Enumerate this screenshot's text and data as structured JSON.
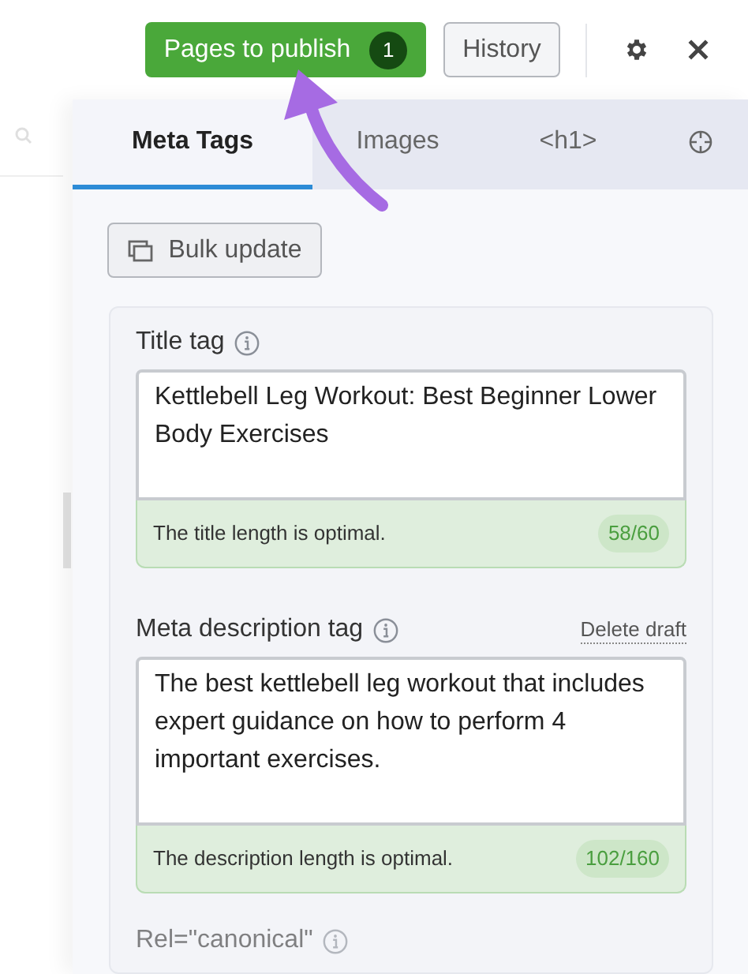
{
  "header": {
    "publish_button": {
      "label": "Pages to publish",
      "count": "1"
    },
    "history_button": "History"
  },
  "tabs": [
    {
      "kind": "text",
      "label": "Meta Tags",
      "selected": true
    },
    {
      "kind": "text",
      "label": "Images",
      "selected": false
    },
    {
      "kind": "text",
      "label": "<h1>",
      "selected": false
    },
    {
      "kind": "icon",
      "selected": false
    }
  ],
  "bulk_update": "Bulk update",
  "fields": [
    {
      "label": "Title tag",
      "value": "Kettlebell Leg Workout: Best Beginner Lower Body Exercises",
      "status": "The title length is optimal.",
      "count": "58/60"
    },
    {
      "label": "Meta description tag",
      "action": "Delete draft",
      "value": "The best kettlebell leg workout that includes expert guidance on how to perform 4 important exercises.",
      "status": "The description length is optimal.",
      "count": "102/160"
    }
  ],
  "next_field": "Rel=\"canonical\""
}
